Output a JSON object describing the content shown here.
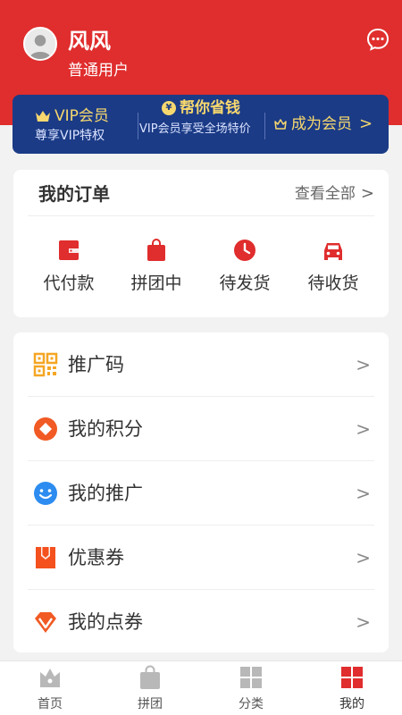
{
  "user": {
    "name": "风风",
    "level": "普通用户"
  },
  "vip_banner": {
    "title": "VIP会员",
    "subtitle": "尊享VIP特权",
    "save_title": "帮你省钱",
    "save_subtitle": "VIP会员享受全场特价",
    "cta": "成为会员",
    "coin_char": "¥",
    "arrow": ">"
  },
  "orders": {
    "title": "我的订单",
    "view_all": "查看全部",
    "view_all_arrow": ">",
    "items": [
      {
        "label": "代付款",
        "icon": "wallet-icon"
      },
      {
        "label": "拼团中",
        "icon": "shopping-bag-icon"
      },
      {
        "label": "待发货",
        "icon": "clock-icon"
      },
      {
        "label": "待收货",
        "icon": "car-icon"
      }
    ]
  },
  "menu": {
    "items": [
      {
        "label": "推广码",
        "icon": "qr-code-icon",
        "arrow": ">"
      },
      {
        "label": "我的积分",
        "icon": "points-icon",
        "arrow": ">"
      },
      {
        "label": "我的推广",
        "icon": "smile-icon",
        "arrow": ">"
      },
      {
        "label": "优惠券",
        "icon": "coupon-icon",
        "arrow": ">"
      },
      {
        "label": "我的点券",
        "icon": "diamond-icon",
        "arrow": ">"
      }
    ]
  },
  "tabbar": {
    "items": [
      {
        "label": "首页",
        "icon": "home-crown-icon",
        "active": false
      },
      {
        "label": "拼团",
        "icon": "bag-icon",
        "active": false
      },
      {
        "label": "分类",
        "icon": "grid-icon",
        "active": false
      },
      {
        "label": "我的",
        "icon": "profile-grid-icon",
        "active": true
      }
    ]
  },
  "colors": {
    "brand_red": "#e02d2d",
    "vip_navy": "#1b3b86",
    "vip_gold": "#f7d86e",
    "qr_orange": "#f5a623",
    "points_orange": "#f15a24",
    "smile_blue": "#2d8cf0",
    "coupon_orange": "#f4511e",
    "tab_inactive": "#b8b8b8",
    "tab_active": "#e02d2d"
  }
}
